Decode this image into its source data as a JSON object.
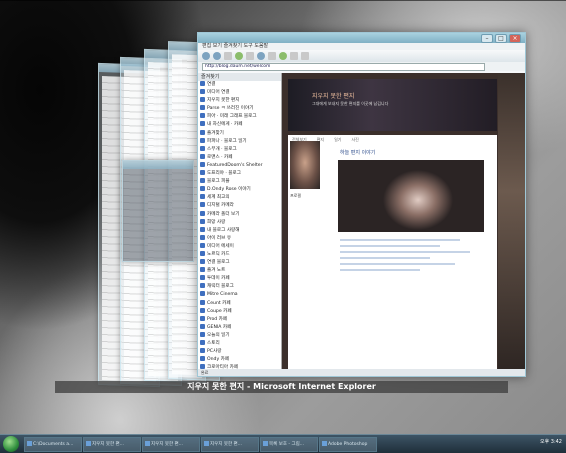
{
  "caption": "지우지 못한 편지 - Microsoft Internet Explorer",
  "browser": {
    "address": "http://blog.daum.net/welcom",
    "menu": "편집 보기 즐겨찾기 도구 도움말",
    "favorites_header": "즐겨찾기",
    "favorites": [
      "연결",
      "미디어 연결",
      "지우지 못한 편지",
      "Parse ㅋ 쓰러진 이야기",
      "피아 · 미래 그래프 블로그",
      "내 자신에게 · 카페",
      "즐겨찾기",
      "파파나 · 블로그 일기",
      "스무개 · 블로그",
      "로맨스 · 카페",
      "FeaturedDoom's Shelter",
      "도프리야 · 블로그",
      "블로그 피플",
      "D.Ondy Rose 이야기",
      "세계 최고의",
      "디지털 카메라",
      "카메라 폴더 보기",
      "희망 사랑",
      "내 블로그 사랑해",
      "아이 러브 유",
      "미디어 에세이",
      "노르딕 카드",
      "연결 블로그",
      "즐겨 노트",
      "투데이 카페",
      "캐릭터 블로그",
      "Mitre Cinema",
      "Ceunt 카페",
      "Coupe 카페",
      "Prod 카페",
      "GENIA 카페",
      "오늘의 일기",
      "스토리",
      "PC사랑",
      "Ondy 카페",
      "크로아티아 카페",
      "Geo 카페",
      "대한 블로그",
      "블로그 파이터"
    ],
    "status": "완료"
  },
  "blog": {
    "title": "지우지 못한 편지",
    "description": "그대에게 보내지 못한 편지를 이곳에 남깁니다",
    "sidebar_profile": "프로필",
    "post_title": "하늘 편지 이야기",
    "categories": [
      "전체보기",
      "편지",
      "일기",
      "사진"
    ]
  },
  "taskbar": {
    "tasks": [
      "C:\\Documents a...",
      "지우지 못한 편...",
      "지우지 못한 편...",
      "지우지 못한 편...",
      "목록 보호 - 그림...",
      "Adobe Photoshop"
    ],
    "clock": "오후 3:42"
  }
}
